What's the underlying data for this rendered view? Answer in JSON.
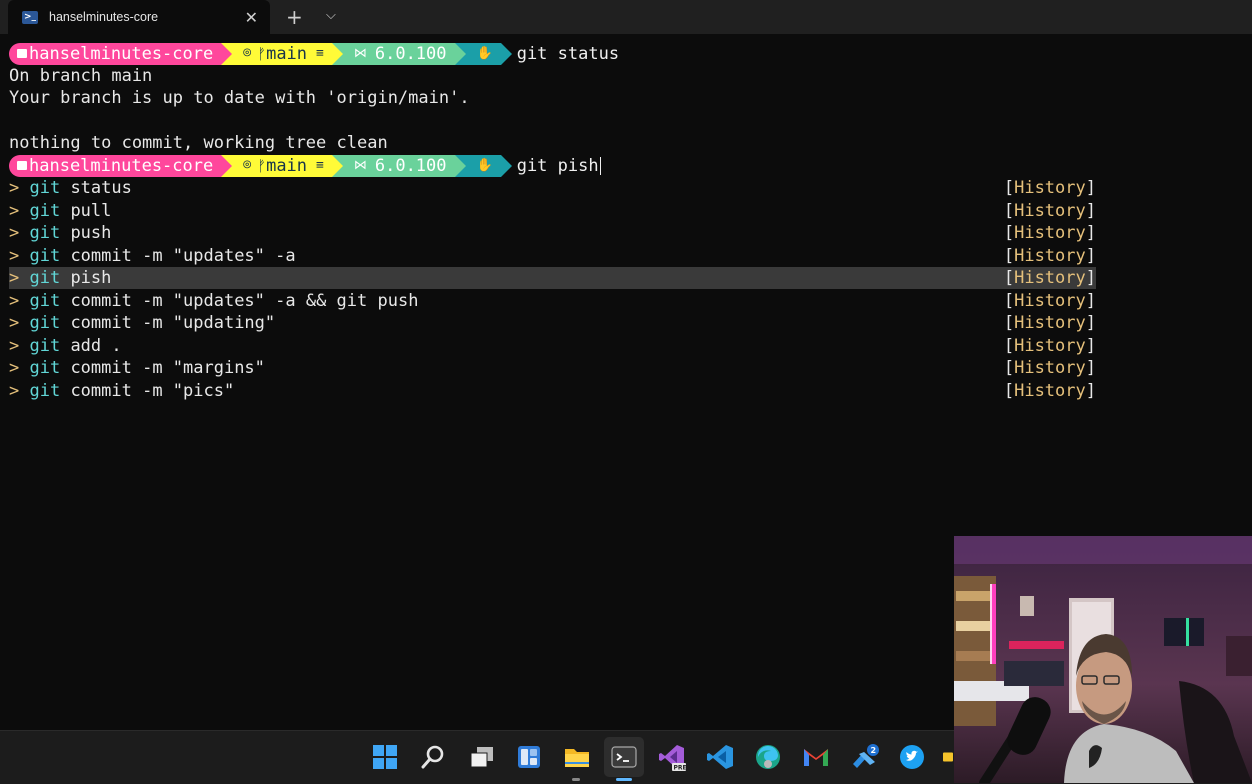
{
  "tab": {
    "title": "hanselminutes-core"
  },
  "prompt": {
    "folder": "hanselminutes-core",
    "branch": "main",
    "dotnet": "6.0.100"
  },
  "commands": {
    "first": "git status",
    "current": "git pish"
  },
  "output": [
    "On branch main",
    "Your branch is up to date with 'origin/main'.",
    "",
    "nothing to commit, working tree clean"
  ],
  "history_tag": "History",
  "predictions": [
    {
      "git": "git",
      "rest": " status",
      "selected": false
    },
    {
      "git": "git",
      "rest": " pull",
      "selected": false
    },
    {
      "git": "git",
      "rest": " push",
      "selected": false
    },
    {
      "git": "git",
      "rest": " commit -m \"updates\" -a",
      "selected": false
    },
    {
      "git": "git",
      "rest": " pish",
      "selected": true
    },
    {
      "git": "git",
      "rest": " commit -m \"updates\" -a && git push",
      "selected": false
    },
    {
      "git": "git",
      "rest": " commit -m \"updating\"",
      "selected": false
    },
    {
      "git": "git",
      "rest": " add .",
      "selected": false
    },
    {
      "git": "git",
      "rest": " commit -m \"margins\"",
      "selected": false
    },
    {
      "git": "git",
      "rest": " commit -m \"pics\"",
      "selected": false
    }
  ],
  "taskbar": {
    "icons": [
      "windows-start-icon",
      "search-icon",
      "task-view-icon",
      "widgets-icon",
      "file-explorer-icon",
      "terminal-icon",
      "visual-studio-preview-icon",
      "vscode-icon",
      "edge-icon",
      "gmail-icon",
      "teams-icon",
      "twitter-icon"
    ],
    "notification_badge": "2"
  },
  "colors": {
    "folder_segment": "#ff479c",
    "git_segment": "#fffb38",
    "dotnet_segment": "#6ad29b",
    "admin_segment": "#1b9fa8",
    "prediction_marker": "#e5c07b",
    "git_keyword": "#61d6d6"
  }
}
